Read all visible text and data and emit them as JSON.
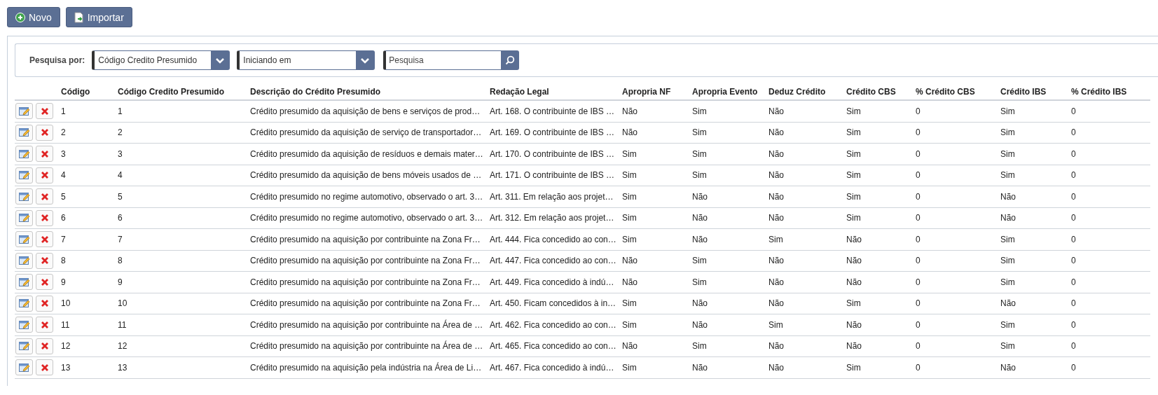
{
  "toolbar": [
    {
      "kind": "new",
      "label": "Novo"
    },
    {
      "kind": "import",
      "label": "Importar"
    }
  ],
  "search": {
    "label": "Pesquisa por:",
    "field": "Código Credito Presumido",
    "mode": "Iniciando em",
    "placeholder": "Pesquisa"
  },
  "table": {
    "columns": [
      "Código",
      "Código Credito Presumido",
      "Descrição do Crédito Presumido",
      "Redação Legal",
      "Apropria NF",
      "Apropria Evento",
      "Deduz Crédito",
      "Crédito CBS",
      "% Crédito CBS",
      "Crédito IBS",
      "% Crédito IBS"
    ],
    "rows": [
      [
        "1",
        "1",
        "Crédito presumido da aquisição de bens e serviços de prod…",
        "Art. 168. O contribuinte de IBS …",
        "Não",
        "Sim",
        "Não",
        "Sim",
        "0",
        "Sim",
        "0"
      ],
      [
        "2",
        "2",
        "Crédito presumido da aquisição de serviço de transportador…",
        "Art. 169. O contribuinte de IBS …",
        "Não",
        "Sim",
        "Não",
        "Sim",
        "0",
        "Sim",
        "0"
      ],
      [
        "3",
        "3",
        "Crédito presumido da aquisição de resíduos e demais mater…",
        "Art. 170. O contribuinte de IBS …",
        "Sim",
        "Sim",
        "Não",
        "Sim",
        "0",
        "Sim",
        "0"
      ],
      [
        "4",
        "4",
        "Crédito presumido da aquisição de bens móveis usados de …",
        "Art. 171. O contribuinte de IBS …",
        "Sim",
        "Sim",
        "Não",
        "Sim",
        "0",
        "Sim",
        "0"
      ],
      [
        "5",
        "5",
        "Crédito presumido no regime automotivo, observado o art. 3…",
        "Art. 311. Em relação aos projet…",
        "Sim",
        "Não",
        "Não",
        "Sim",
        "0",
        "Não",
        "0"
      ],
      [
        "6",
        "6",
        "Crédito presumido no regime automotivo, observado o art. 3…",
        "Art. 312. Em relação aos projet…",
        "Sim",
        "Não",
        "Não",
        "Sim",
        "0",
        "Não",
        "0"
      ],
      [
        "7",
        "7",
        "Crédito presumido na aquisição por contribuinte na Zona Fr…",
        "Art. 444. Fica concedido ao con…",
        "Sim",
        "Não",
        "Sim",
        "Não",
        "0",
        "Sim",
        "0"
      ],
      [
        "8",
        "8",
        "Crédito presumido na aquisição por contribuinte na Zona Fr…",
        "Art. 447. Fica concedido ao con…",
        "Não",
        "Sim",
        "Não",
        "Não",
        "0",
        "Sim",
        "0"
      ],
      [
        "9",
        "9",
        "Crédito presumido na aquisição por contribuinte na Zona Fr…",
        "Art. 449. Fica concedido à indú…",
        "Não",
        "Sim",
        "Não",
        "Não",
        "0",
        "Sim",
        "0"
      ],
      [
        "10",
        "10",
        "Crédito presumido na aquisição por contribuinte na Zona Fr…",
        "Art. 450. Ficam concedidos à in…",
        "Sim",
        "Não",
        "Não",
        "Sim",
        "0",
        "Não",
        "0"
      ],
      [
        "11",
        "11",
        "Crédito presumido na aquisição por contribuinte na Área de …",
        "Art. 462. Fica concedido ao con…",
        "Sim",
        "Não",
        "Sim",
        "Não",
        "0",
        "Sim",
        "0"
      ],
      [
        "12",
        "12",
        "Crédito presumido na aquisição por contribuinte na Área de …",
        "Art. 465. Fica concedido ao con…",
        "Não",
        "Sim",
        "Não",
        "Não",
        "0",
        "Sim",
        "0"
      ],
      [
        "13",
        "13",
        "Crédito presumido na aquisição pela indústria na Área de Li…",
        "Art. 467. Fica concedido à indú…",
        "Sim",
        "Não",
        "Não",
        "Sim",
        "0",
        "Não",
        "0"
      ]
    ]
  }
}
